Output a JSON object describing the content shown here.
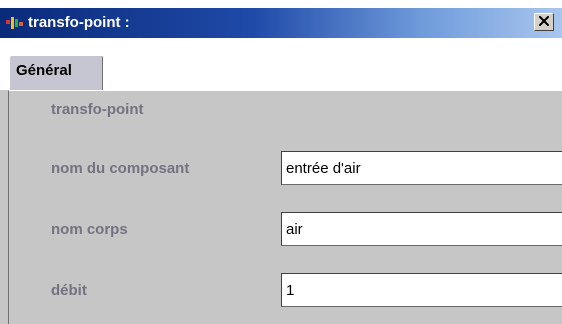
{
  "window": {
    "title": "transfo-point :",
    "close_label": "×",
    "colors": {
      "titlebar_start": "#0a2a7a",
      "titlebar_end": "#a9c6ee",
      "panel_bg": "#c6c6c6",
      "label_color": "#737380"
    }
  },
  "tabs": [
    {
      "label": "Général",
      "selected": true
    }
  ],
  "form": {
    "section_title": "transfo-point",
    "fields": [
      {
        "label": "nom du composant",
        "value": "entrée d'air"
      },
      {
        "label": "nom corps",
        "value": "air"
      },
      {
        "label": "débit",
        "value": "1"
      }
    ]
  },
  "icons": {
    "app": "app-icon",
    "close": "close-icon"
  }
}
